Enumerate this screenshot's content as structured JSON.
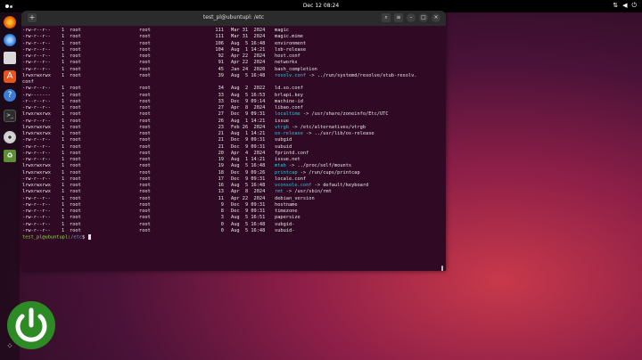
{
  "topbar": {
    "clock": "Dec 12  08:24"
  },
  "dock": {
    "apps": [
      {
        "name": "firefox-icon",
        "color": "#e66000"
      },
      {
        "name": "thunderbird-icon",
        "color": "#1f6fd1"
      },
      {
        "name": "files-icon",
        "color": "#d9d9d9"
      },
      {
        "name": "app-center-icon",
        "color": "#e9541c"
      },
      {
        "name": "help-icon",
        "color": "#3a7bd5"
      },
      {
        "name": "terminal-icon",
        "color": "#333333"
      },
      {
        "name": "disc-icon",
        "color": "#e0e0e0"
      },
      {
        "name": "trash-icon",
        "color": "#6a9e3a"
      },
      {
        "name": "show-apps-icon",
        "color": "#ffffff"
      }
    ]
  },
  "window": {
    "title": "test_pl@ubuntupl: /etc",
    "newtab_label": "+",
    "search_label": "⌕",
    "menu_label": "≡",
    "minimize_label": "–",
    "maximize_label": "□",
    "close_label": "×"
  },
  "listing": [
    {
      "perm": "-rw-r--r--",
      "links": "1",
      "owner": "root",
      "group": "root",
      "size": "111",
      "date": "Mar 31  2024",
      "name": "magic",
      "target": ""
    },
    {
      "perm": "-rw-r--r--",
      "links": "1",
      "owner": "root",
      "group": "root",
      "size": "111",
      "date": "Mar 31  2024",
      "name": "magic.mime",
      "target": ""
    },
    {
      "perm": "-rw-r--r--",
      "links": "1",
      "owner": "root",
      "group": "root",
      "size": "106",
      "date": "Aug  5 16:48",
      "name": "environment",
      "target": ""
    },
    {
      "perm": "-rw-r--r--",
      "links": "1",
      "owner": "root",
      "group": "root",
      "size": "104",
      "date": "Aug  1 14:21",
      "name": "lsb-release",
      "target": ""
    },
    {
      "perm": "-rw-r--r--",
      "links": "1",
      "owner": "root",
      "group": "root",
      "size": "92",
      "date": "Apr 22  2024",
      "name": "host.conf",
      "target": ""
    },
    {
      "perm": "-rw-r--r--",
      "links": "1",
      "owner": "root",
      "group": "root",
      "size": "91",
      "date": "Apr 22  2024",
      "name": "networks",
      "target": ""
    },
    {
      "perm": "-rw-r--r--",
      "links": "1",
      "owner": "root",
      "group": "root",
      "size": "45",
      "date": "Jan 24  2020",
      "name": "bash_completion",
      "target": ""
    },
    {
      "perm": "lrwxrwxrwx",
      "links": "1",
      "owner": "root",
      "group": "root",
      "size": "39",
      "date": "Aug  5 16:48",
      "name": "resolv.conf",
      "target": " -> ../run/systemd/resolve/stub-resolv."
    },
    {
      "perm": "conf",
      "links": "",
      "owner": "",
      "group": "",
      "size": "",
      "date": "",
      "name": "",
      "target": ""
    },
    {
      "perm": "-rw-r--r--",
      "links": "1",
      "owner": "root",
      "group": "root",
      "size": "34",
      "date": "Aug  2  2022",
      "name": "ld.so.conf",
      "target": ""
    },
    {
      "perm": "-rw-------",
      "links": "1",
      "owner": "root",
      "group": "root",
      "size": "33",
      "date": "Aug  5 16:53",
      "name": "brlapi.key",
      "target": ""
    },
    {
      "perm": "-r--r--r--",
      "links": "1",
      "owner": "root",
      "group": "root",
      "size": "33",
      "date": "Dec  9 09:14",
      "name": "machine-id",
      "target": ""
    },
    {
      "perm": "-rw-r--r--",
      "links": "1",
      "owner": "root",
      "group": "root",
      "size": "27",
      "date": "Apr  8  2024",
      "name": "libao.conf",
      "target": ""
    },
    {
      "perm": "lrwxrwxrwx",
      "links": "1",
      "owner": "root",
      "group": "root",
      "size": "27",
      "date": "Dec  9 09:31",
      "name": "localtime",
      "target": " -> /usr/share/zoneinfo/Etc/UTC"
    },
    {
      "perm": "-rw-r--r--",
      "links": "1",
      "owner": "root",
      "group": "root",
      "size": "26",
      "date": "Aug  1 14:21",
      "name": "issue",
      "target": ""
    },
    {
      "perm": "lrwxrwxrwx",
      "links": "1",
      "owner": "root",
      "group": "root",
      "size": "23",
      "date": "Feb 26  2024",
      "name": "vtrgb",
      "target": " -> /etc/alternatives/vtrgb"
    },
    {
      "perm": "lrwxrwxrwx",
      "links": "1",
      "owner": "root",
      "group": "root",
      "size": "21",
      "date": "Aug  1 14:21",
      "name": "os-release",
      "target": " -> ../usr/lib/os-release"
    },
    {
      "perm": "-rw-r--r--",
      "links": "1",
      "owner": "root",
      "group": "root",
      "size": "21",
      "date": "Dec  9 09:31",
      "name": "subgid",
      "target": ""
    },
    {
      "perm": "-rw-r--r--",
      "links": "1",
      "owner": "root",
      "group": "root",
      "size": "21",
      "date": "Dec  9 09:31",
      "name": "subuid",
      "target": ""
    },
    {
      "perm": "-rw-r--r--",
      "links": "1",
      "owner": "root",
      "group": "root",
      "size": "20",
      "date": "Apr  4  2024",
      "name": "fprintd.conf",
      "target": ""
    },
    {
      "perm": "-rw-r--r--",
      "links": "1",
      "owner": "root",
      "group": "root",
      "size": "19",
      "date": "Aug  1 14:21",
      "name": "issue.net",
      "target": ""
    },
    {
      "perm": "lrwxrwxrwx",
      "links": "1",
      "owner": "root",
      "group": "root",
      "size": "19",
      "date": "Aug  5 16:48",
      "name": "mtab",
      "target": " -> ../proc/self/mounts"
    },
    {
      "perm": "lrwxrwxrwx",
      "links": "1",
      "owner": "root",
      "group": "root",
      "size": "18",
      "date": "Dec  9 09:26",
      "name": "printcap",
      "target": " -> /run/cups/printcap"
    },
    {
      "perm": "-rw-r--r--",
      "links": "1",
      "owner": "root",
      "group": "root",
      "size": "17",
      "date": "Dec  9 09:31",
      "name": "locale.conf",
      "target": ""
    },
    {
      "perm": "lrwxrwxrwx",
      "links": "1",
      "owner": "root",
      "group": "root",
      "size": "16",
      "date": "Aug  5 16:48",
      "name": "vconsole.conf",
      "target": " -> default/keyboard"
    },
    {
      "perm": "lrwxrwxrwx",
      "links": "1",
      "owner": "root",
      "group": "root",
      "size": "13",
      "date": "Apr  8  2024",
      "name": "rmt",
      "target": " -> /usr/sbin/rmt"
    },
    {
      "perm": "-rw-r--r--",
      "links": "1",
      "owner": "root",
      "group": "root",
      "size": "11",
      "date": "Apr 22  2024",
      "name": "debian_version",
      "target": ""
    },
    {
      "perm": "-rw-r--r--",
      "links": "1",
      "owner": "root",
      "group": "root",
      "size": "9",
      "date": "Dec  9 09:31",
      "name": "hostname",
      "target": ""
    },
    {
      "perm": "-rw-r--r--",
      "links": "1",
      "owner": "root",
      "group": "root",
      "size": "8",
      "date": "Dec  9 09:31",
      "name": "timezone",
      "target": ""
    },
    {
      "perm": "-rw-r--r--",
      "links": "1",
      "owner": "root",
      "group": "root",
      "size": "3",
      "date": "Aug  5 16:51",
      "name": "papersize",
      "target": ""
    },
    {
      "perm": "-rw-r--r--",
      "links": "1",
      "owner": "root",
      "group": "root",
      "size": "0",
      "date": "Aug  5 16:48",
      "name": "subgid-",
      "target": ""
    },
    {
      "perm": "-rw-r--r--",
      "links": "1",
      "owner": "root",
      "group": "root",
      "size": "0",
      "date": "Aug  5 16:48",
      "name": "subuid-",
      "target": ""
    }
  ],
  "prompt": {
    "user_host": "test_pl@ubuntupl",
    "sep": ":",
    "path": "/etc",
    "symbol": "$"
  }
}
